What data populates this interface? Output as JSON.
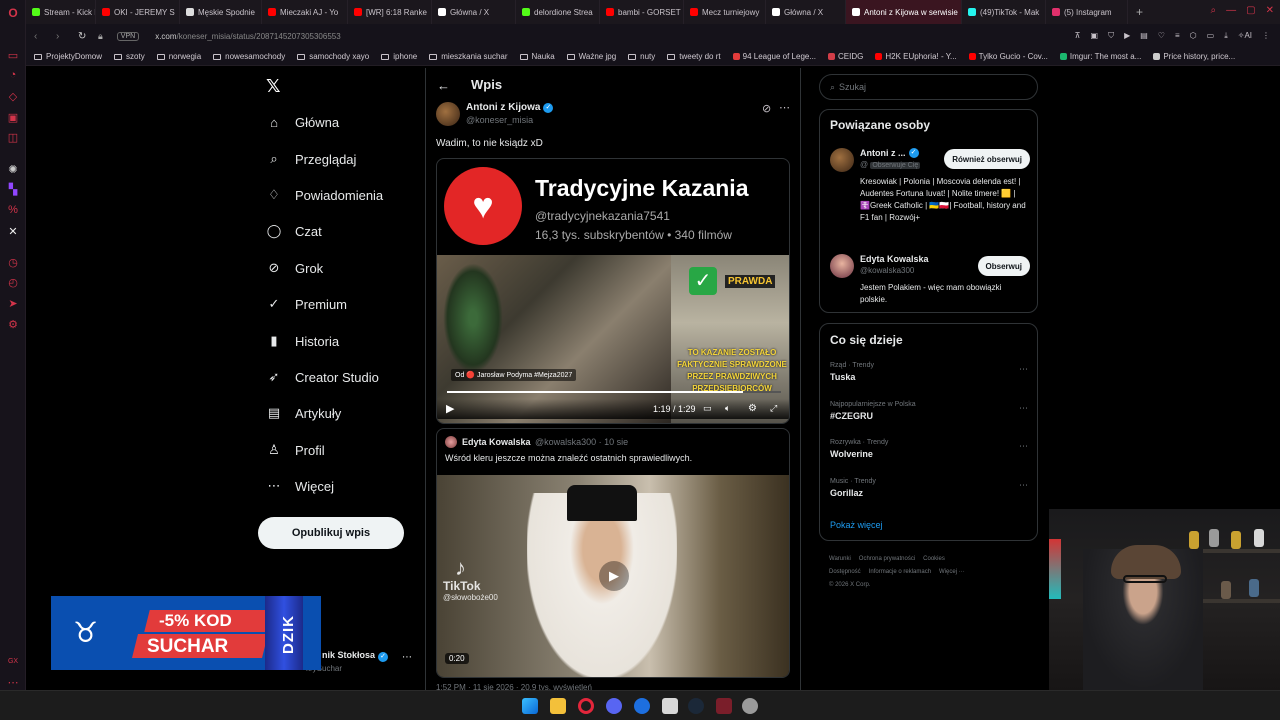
{
  "browser": {
    "tabs": [
      {
        "label": "Stream - Kick Da",
        "color": "#53fc18",
        "active": false
      },
      {
        "label": "OKI - JEREMY S",
        "color": "#ff0000",
        "active": false
      },
      {
        "label": "Męskie Spodnie",
        "color": "#dddddd",
        "active": false
      },
      {
        "label": "Mieczaki AJ - Yo",
        "color": "#ff0000",
        "active": false
      },
      {
        "label": "[WR] 6:18 Ranke",
        "color": "#ff0000",
        "active": false
      },
      {
        "label": "Główna / X",
        "color": "#ffffff",
        "active": false
      },
      {
        "label": "delordione Strea",
        "color": "#53fc18",
        "active": false
      },
      {
        "label": "bambi - GORSET",
        "color": "#ff0000",
        "active": false
      },
      {
        "label": "Mecz turniejowy",
        "color": "#ff0000",
        "active": false
      },
      {
        "label": "Główna / X",
        "color": "#ffffff",
        "active": false
      },
      {
        "label": "Antoni z Kijowa w serwisie",
        "color": "#ffffff",
        "active": true
      },
      {
        "label": "(49)TikTok - Mak",
        "color": "#25f4ee",
        "active": false
      },
      {
        "label": "(5) Instagram",
        "color": "#e1306c",
        "active": false
      }
    ],
    "vpn": "VPN",
    "url_host": "x.com",
    "url_path": "/koneser_misia/status/2087145207305306553",
    "ai_label": "AI",
    "bookmarks": [
      {
        "label": "ProjektyDomow",
        "type": "folder"
      },
      {
        "label": "szoty",
        "type": "folder"
      },
      {
        "label": "norwegia",
        "type": "folder"
      },
      {
        "label": "nowesamochody",
        "type": "folder"
      },
      {
        "label": "samochody xayo",
        "type": "folder"
      },
      {
        "label": "iphone",
        "type": "folder"
      },
      {
        "label": "mieszkania suchar",
        "type": "folder"
      },
      {
        "label": "Nauka",
        "type": "folder"
      },
      {
        "label": "Ważne jpg",
        "type": "folder"
      },
      {
        "label": "nuty",
        "type": "folder"
      },
      {
        "label": "tweety do rt",
        "type": "folder"
      },
      {
        "label": "94 League of Lege...",
        "type": "site",
        "color": "#e23b3b"
      },
      {
        "label": "CEIDG",
        "type": "site",
        "color": "#d23d48"
      },
      {
        "label": "H2K EUphoria! - Y...",
        "type": "site",
        "color": "#ff0000"
      },
      {
        "label": "Tylko Gucio - Cov...",
        "type": "site",
        "color": "#ff0000"
      },
      {
        "label": "Imgur: The most a...",
        "type": "site",
        "color": "#1bb76e"
      },
      {
        "label": "Price history, price...",
        "type": "site",
        "color": "#cccccc"
      }
    ]
  },
  "x": {
    "nav": [
      {
        "label": "Główna",
        "icon": "⌂",
        "name": "home"
      },
      {
        "label": "Przeglądaj",
        "icon": "⌕",
        "name": "explore"
      },
      {
        "label": "Powiadomienia",
        "icon": "♢",
        "name": "notifications"
      },
      {
        "label": "Czat",
        "icon": "◯",
        "name": "chat"
      },
      {
        "label": "Grok",
        "icon": "⊘",
        "name": "grok"
      },
      {
        "label": "Premium",
        "icon": "✓",
        "name": "premium"
      },
      {
        "label": "Historia",
        "icon": "▮",
        "name": "history"
      },
      {
        "label": "Creator Studio",
        "icon": "➶",
        "name": "creator-studio"
      },
      {
        "label": "Artykuły",
        "icon": "▤",
        "name": "articles"
      },
      {
        "label": "Profil",
        "icon": "♙",
        "name": "profile"
      },
      {
        "label": "Więcej",
        "icon": "⋯",
        "name": "more"
      }
    ],
    "post_button": "Opublikuj wpis",
    "account": {
      "name": "nik Stokłosa",
      "handle": "krySuchar"
    },
    "promo": {
      "discount": "-5% KOD",
      "code": "SUCHAR",
      "brand": "DZIK"
    }
  },
  "post": {
    "header": "Wpis",
    "author": "Antoni z Kijowa",
    "handle": "@koneser_misia",
    "text": "Wadim, to nie ksiądz xD",
    "video": {
      "channel_name": "Tradycyjne Kazania",
      "channel_handle": "@tradycyjnekazania7541",
      "channel_stats": "16,3 tys. subskrybentów • 340 filmów",
      "truth_label": "PRAWDA",
      "caption": "TO KAZANIE ZOSTAŁO FAKTYCZNIE SPRAWDZONE PRZEZ PRAWDZIWYCH PRZEDSIĘBIORCÓW",
      "from": "Od 🔴 Jarosław Podyma #Mejza2027",
      "time": "1:19 / 1:29",
      "progress": 0.887
    },
    "quote": {
      "author": "Edyta Kowalska",
      "meta": "@kowalska300 · 10 sie",
      "text": "Wśród kleru jeszcze można znaleźć ostatnich sprawiedliwych.",
      "tiktok_label": "TikTok",
      "tiktok_handle": "@słowoboże00",
      "duration": "0:20"
    },
    "timestamp": "1:52 PM · 11 sie 2026 · 20,9 tys. wyświetleń"
  },
  "sidebar": {
    "search_placeholder": "Szukaj",
    "related_title": "Powiązane osoby",
    "related": [
      {
        "name": "Antoni z ...",
        "handle": "@",
        "follows_you": "Obserwuje Cię",
        "button": "Również obserwuj",
        "bio": "Kresowiak | Polonia | Moscovia delenda est! | Audentes Fortuna Iuvat! | Nolite timere! 🟨 | ☦️Greek Catholic | 🇺🇦🇵🇱| Football, history and F1 fan | Rozwój+"
      },
      {
        "name": "Edyta Kowalska",
        "handle": "@kowalska300",
        "follows_you": "",
        "button": "Obserwuj",
        "bio": "Jestem Polakiem - więc mam obowiązki polskie."
      }
    ],
    "trends_title": "Co się dzieje",
    "trends": [
      {
        "context": "Rząd · Trendy",
        "name": "Tuska"
      },
      {
        "context": "Najpopularniejsze w Polska",
        "name": "#CZEGRU"
      },
      {
        "context": "Rozrywka · Trendy",
        "name": "Wolverine"
      },
      {
        "context": "Music · Trendy",
        "name": "Gorillaz"
      }
    ],
    "show_more": "Pokaż więcej",
    "footer": [
      "Warunki",
      "Ochrona prywatności",
      "Cookies",
      "Dostępność",
      "Informacje o reklamach",
      "Więcej ···",
      "© 2026 X Corp."
    ]
  }
}
